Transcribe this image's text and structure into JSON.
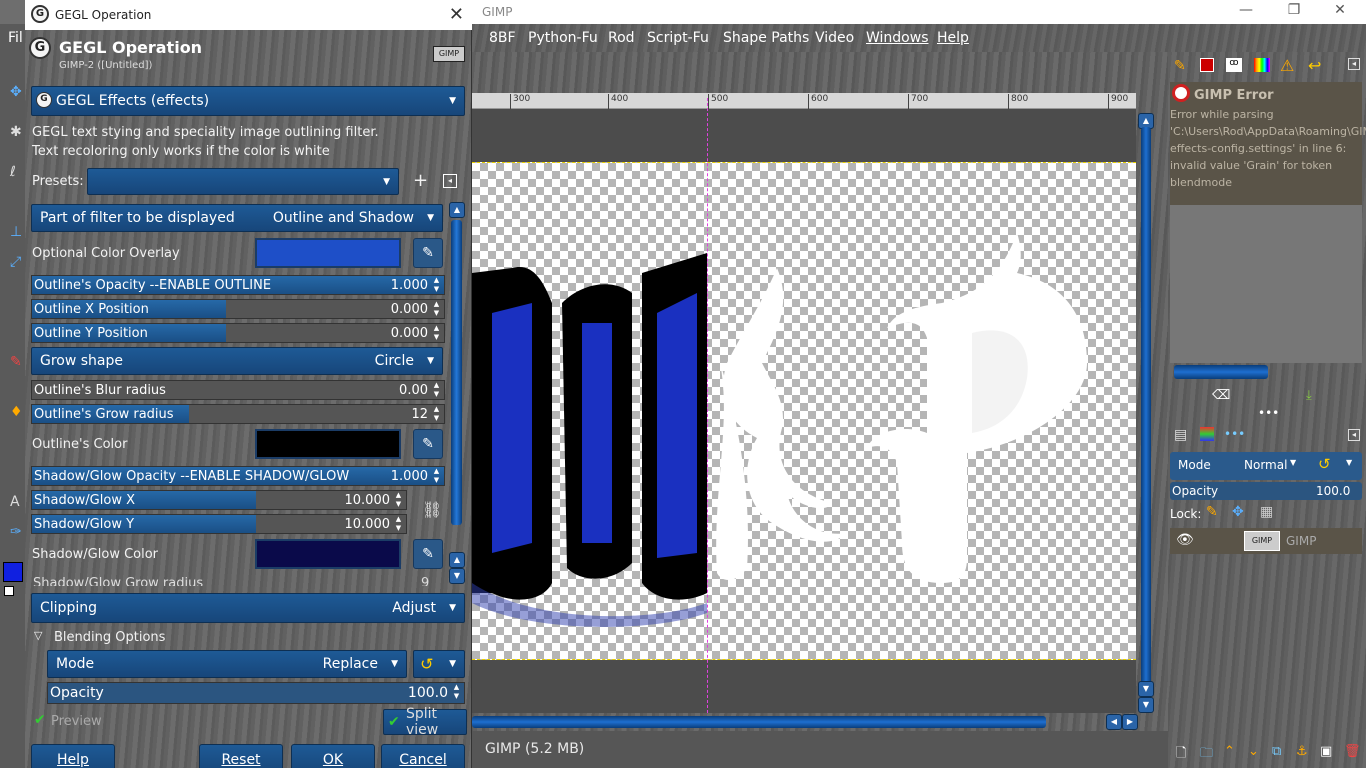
{
  "gimp_window": {
    "title": "GIMP",
    "min_btn": "—",
    "max_btn": "❐",
    "close_btn": "✕",
    "menus": [
      "Fil",
      "8BF",
      "Python-Fu",
      "Rod",
      "Script-Fu",
      "Shape Paths",
      "Video",
      "Windows",
      "Help"
    ],
    "ruler_ticks": [
      "300",
      "400",
      "500",
      "600",
      "700",
      "800",
      "900"
    ],
    "status": "GIMP (5.2 MB)"
  },
  "error_panel": {
    "title": "GIMP Error",
    "message": "Error while parsing 'C:\\Users\\Rod\\AppData\\Roaming\\GIMP\\gegl-effects-config.settings' in line 6: invalid value 'Grain' for token blendmode"
  },
  "layers_panel": {
    "mode_label": "Mode",
    "mode_value": "Normal",
    "opacity_label": "Opacity",
    "opacity_value": "100.0",
    "lock_label": "Lock:",
    "layer_name": "GIMP",
    "thumb_text": "GIMP"
  },
  "dialog": {
    "window_title": "GEGL Operation",
    "header_title": "GEGL Operation",
    "header_sub": "GIMP-2 ([Untitled])",
    "thumb_text": "GIMP",
    "operation": "GEGL Effects (effects)",
    "description_line1": "GEGL text stying and speciality image outlining filter.",
    "description_line2": "Text recoloring only works if the color is white",
    "presets_label": "Presets:",
    "part_label": "Part of filter to be displayed",
    "part_value": "Outline and Shadow",
    "optional_color_label": "Optional Color Overlay",
    "outline_opacity": {
      "label": "Outline's Opacity --ENABLE OUTLINE",
      "value": "1.000",
      "fraction": 1.0
    },
    "outline_x": {
      "label": "Outline X Position",
      "value": "0.000",
      "fraction": 0.47
    },
    "outline_y": {
      "label": "Outline Y Position",
      "value": "0.000",
      "fraction": 0.47
    },
    "grow_shape_label": "Grow shape",
    "grow_shape_value": "Circle",
    "outline_blur": {
      "label": "Outline's Blur radius",
      "value": "0.00",
      "fraction": 0.0
    },
    "outline_grow": {
      "label": "Outline's Grow radius",
      "value": "12",
      "fraction": 0.38
    },
    "outline_color_label": "Outline's Color",
    "shadow_opacity": {
      "label": "Shadow/Glow Opacity --ENABLE SHADOW/GLOW",
      "value": "1.000",
      "fraction": 1.0
    },
    "shadow_x": {
      "label": "Shadow/Glow X",
      "value": "10.000",
      "fraction": 0.6
    },
    "shadow_y": {
      "label": "Shadow/Glow Y",
      "value": "10.000",
      "fraction": 0.6
    },
    "shadow_color_label": "Shadow/Glow Color",
    "shadow_grow_partial": "Shadow/Glow Grow radius",
    "shadow_grow_partial_value": "9",
    "clipping_label": "Clipping",
    "clipping_value": "Adjust",
    "blending_label": "Blending Options",
    "mode_label": "Mode",
    "mode_value": "Replace",
    "opacity_label": "Opacity",
    "opacity_value": "100.0",
    "preview_label": "Preview",
    "split_view_label": "Split view",
    "buttons": {
      "help": "Help",
      "reset": "Reset",
      "ok": "OK",
      "cancel": "Cancel"
    }
  },
  "colors": {
    "accent_blue": "#1e5a96",
    "overlay_color": "#1e4fc8",
    "outline_color": "#000000",
    "shadow_color": "#0a0a4a",
    "fg_color": "#1020e0"
  }
}
